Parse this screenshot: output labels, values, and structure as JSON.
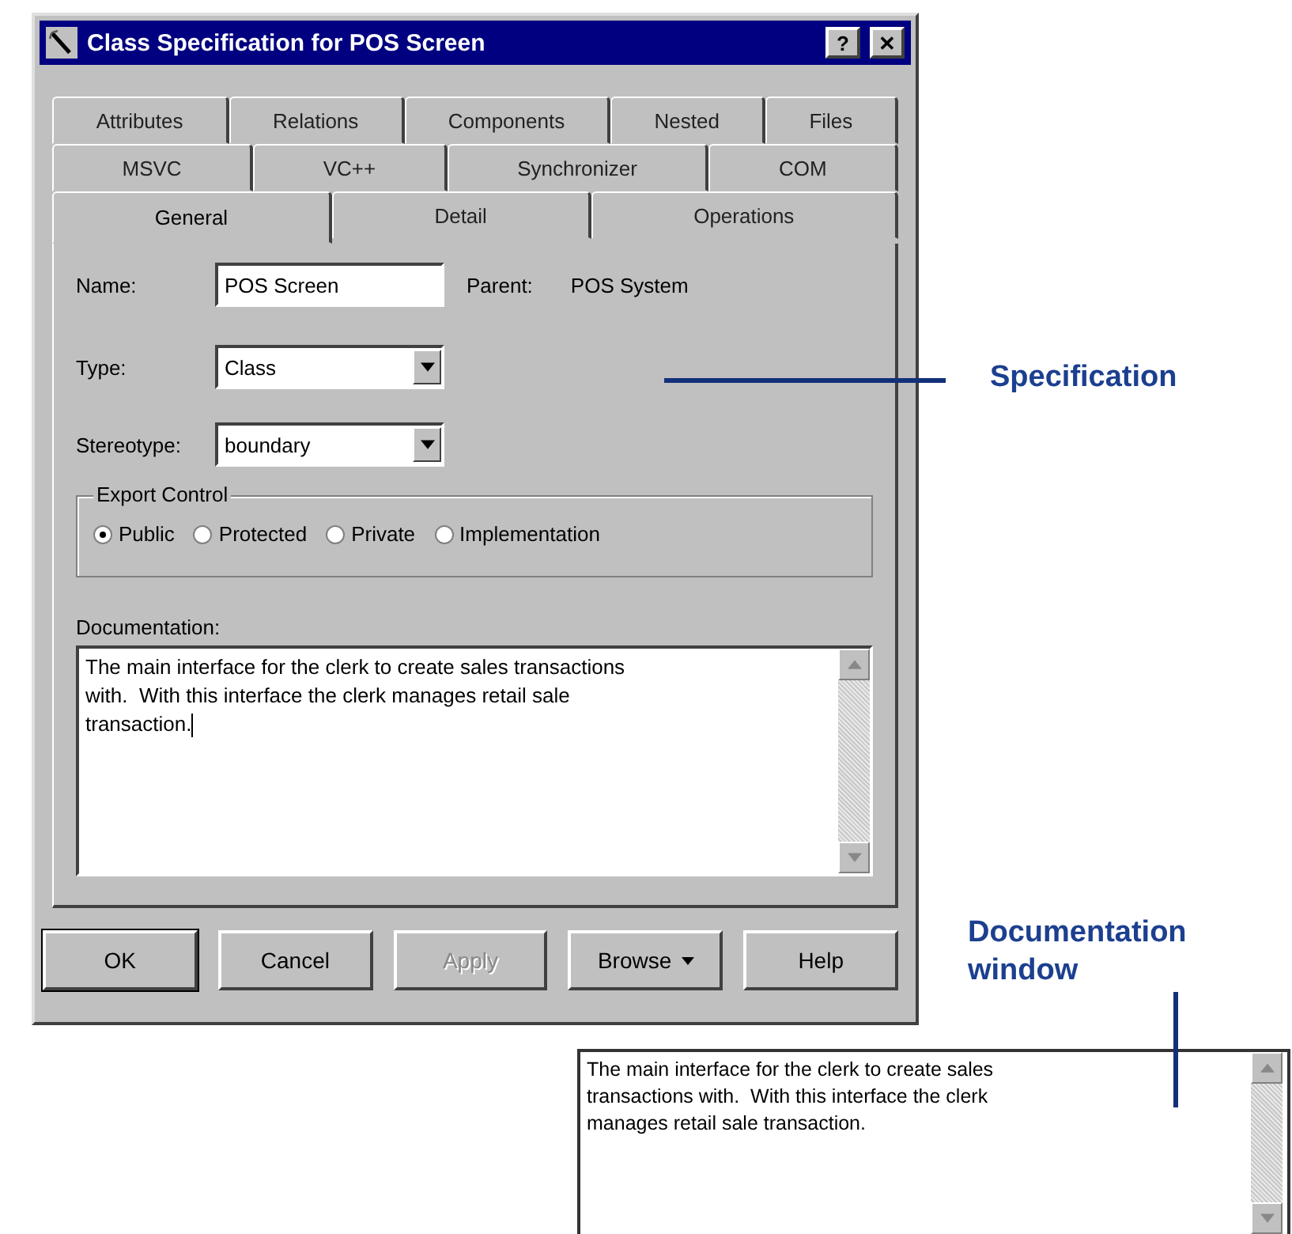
{
  "window": {
    "title": "Class Specification for POS Screen",
    "help_button": "?",
    "close_button": "✕"
  },
  "tab_rows": [
    [
      {
        "label": "Attributes",
        "selected": false
      },
      {
        "label": "Relations",
        "selected": false
      },
      {
        "label": "Components",
        "selected": false
      },
      {
        "label": "Nested",
        "selected": false
      },
      {
        "label": "Files",
        "selected": false
      }
    ],
    [
      {
        "label": "MSVC",
        "selected": false
      },
      {
        "label": "VC++",
        "selected": false
      },
      {
        "label": "Synchronizer",
        "selected": false
      },
      {
        "label": "COM",
        "selected": false
      }
    ],
    [
      {
        "label": "General",
        "selected": true
      },
      {
        "label": "Detail",
        "selected": false
      },
      {
        "label": "Operations",
        "selected": false
      }
    ]
  ],
  "form": {
    "name": {
      "label": "Name:",
      "value": "POS Screen"
    },
    "parent": {
      "label": "Parent:",
      "value": "POS System"
    },
    "type": {
      "label": "Type:",
      "value": "Class"
    },
    "stereotype": {
      "label": "Stereotype:",
      "value": "boundary"
    }
  },
  "export_control": {
    "title": "Export Control",
    "options": [
      {
        "label": "Public",
        "selected": true
      },
      {
        "label": "Protected",
        "selected": false
      },
      {
        "label": "Private",
        "selected": false
      },
      {
        "label": "Implementation",
        "selected": false
      }
    ]
  },
  "documentation": {
    "label": "Documentation:",
    "text": "The main interface for the clerk to create sales transactions\nwith.  With this interface the clerk manages retail sale\ntransaction.",
    "focused": true
  },
  "buttons": [
    {
      "label": "OK",
      "default": true,
      "disabled": false,
      "dropdown": false
    },
    {
      "label": "Cancel",
      "default": false,
      "disabled": false,
      "dropdown": false
    },
    {
      "label": "Apply",
      "default": false,
      "disabled": true,
      "dropdown": false
    },
    {
      "label": "Browse",
      "default": false,
      "disabled": false,
      "dropdown": true
    },
    {
      "label": "Help",
      "default": false,
      "disabled": false,
      "dropdown": false
    }
  ],
  "callouts": [
    {
      "label": "Specification"
    },
    {
      "label": "Documentation window"
    }
  ],
  "documentation_window": {
    "text": "The main interface for the clerk to create sales\ntransactions with.  With this interface the clerk\nmanages retail sale transaction."
  }
}
